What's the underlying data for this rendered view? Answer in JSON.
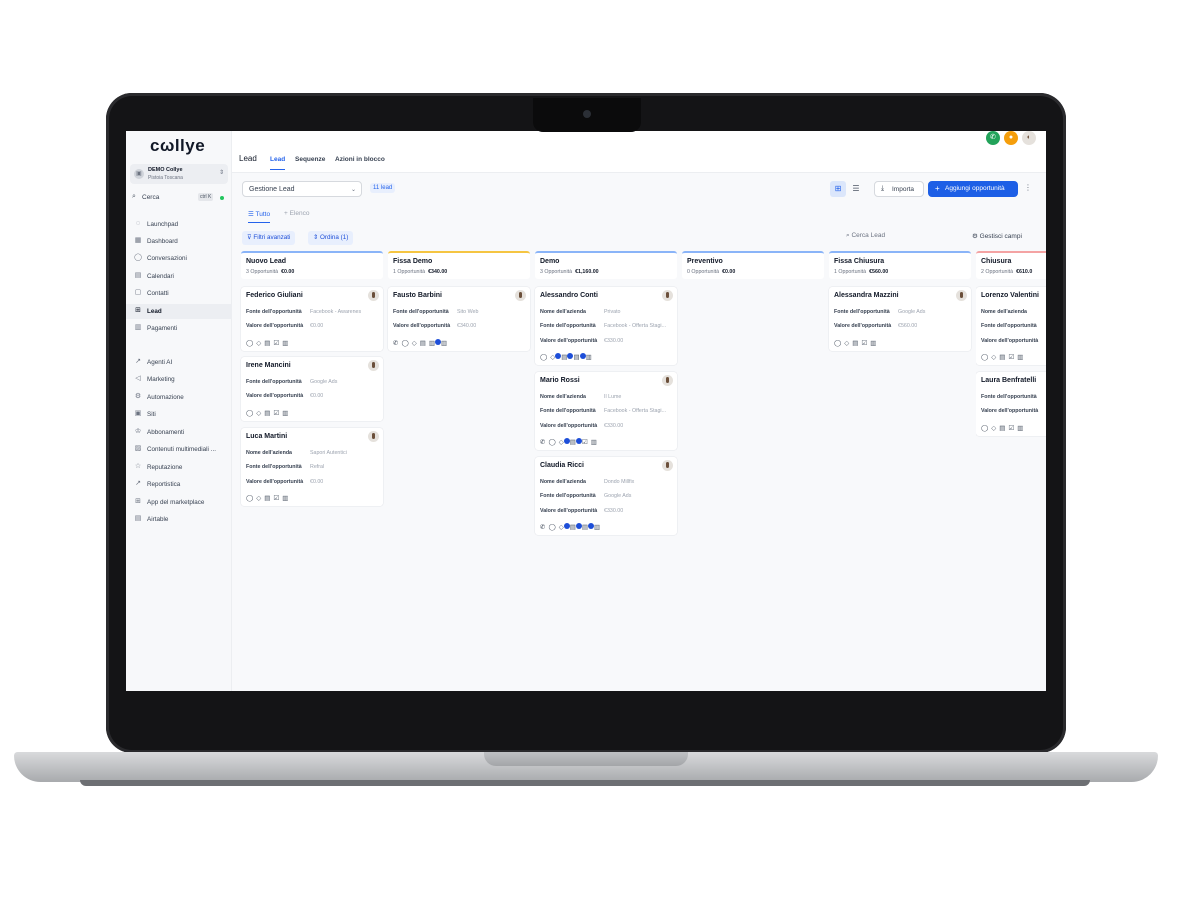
{
  "sidebar": {
    "logo": "cωllye",
    "account": {
      "name": "DEMO Collye",
      "location": "Pistoia Toscana"
    },
    "search": {
      "label": "Cerca",
      "shortcut": "ctrl K"
    },
    "items": [
      {
        "label": "Launchpad",
        "icon": "rocket-icon"
      },
      {
        "label": "Dashboard",
        "icon": "dashboard-icon"
      },
      {
        "label": "Conversazioni",
        "icon": "chat-icon"
      },
      {
        "label": "Calendari",
        "icon": "calendar-icon"
      },
      {
        "label": "Contatti",
        "icon": "contacts-icon"
      },
      {
        "label": "Lead",
        "icon": "lead-icon"
      },
      {
        "label": "Pagamenti",
        "icon": "payments-icon"
      },
      {
        "label": "Agenti AI",
        "icon": "ai-icon"
      },
      {
        "label": "Marketing",
        "icon": "send-icon"
      },
      {
        "label": "Automazione",
        "icon": "automation-icon"
      },
      {
        "label": "Siti",
        "icon": "sites-icon"
      },
      {
        "label": "Abbonamenti",
        "icon": "subscription-icon"
      },
      {
        "label": "Contenuti multimediali ...",
        "icon": "media-icon"
      },
      {
        "label": "Reputazione",
        "icon": "star-icon"
      },
      {
        "label": "Reportistica",
        "icon": "chart-icon"
      },
      {
        "label": "App del marketplace",
        "icon": "apps-icon"
      },
      {
        "label": "Airtable",
        "icon": "table-icon"
      }
    ]
  },
  "header": {
    "title": "Lead",
    "tabs": [
      "Lead",
      "Sequenze",
      "Azioni in blocco"
    ]
  },
  "toolbar": {
    "pipeline": "Gestione Lead",
    "lead_count": "11 lead",
    "import_label": "Importa",
    "add_label": "Aggiungi opportunità"
  },
  "subtabs": {
    "all": "Tutto",
    "list": "Elenco"
  },
  "filters": {
    "advanced": "Filtri avanzati",
    "sort": "Ordina (1)",
    "search_placeholder": "Cerca Lead",
    "manage_fields": "Gestisci campi"
  },
  "labels": {
    "source": "Fonte dell'opportunità",
    "value": "Valore dell'opportunità",
    "company": "Nome dell'azienda"
  },
  "columns": [
    {
      "title": "Nuovo Lead",
      "count": "3 Opportunità",
      "amount": "€0.00",
      "cards": [
        {
          "name": "Federico Giuliani",
          "source": "Facebook - Awarenes",
          "value": "€0.00"
        },
        {
          "name": "Irene Mancini",
          "source": "Google Ads",
          "value": "€0.00"
        },
        {
          "name": "Luca Martini",
          "company": "Sapori Autentici",
          "source": "Refral",
          "value": "€0.00"
        }
      ]
    },
    {
      "title": "Fissa Demo",
      "count": "1 Opportunità",
      "amount": "€340.00",
      "cards": [
        {
          "name": "Fausto Barbini",
          "source": "Sito Web",
          "value": "€340.00"
        }
      ]
    },
    {
      "title": "Demo",
      "count": "3 Opportunità",
      "amount": "€1,160.00",
      "cards": [
        {
          "name": "Alessandro Conti",
          "company": "Privato",
          "source": "Facebook - Offerta Stagi...",
          "value": "€330.00"
        },
        {
          "name": "Mario Rossi",
          "company": "Il Lume",
          "source": "Facebook - Offerta Stagi...",
          "value": "€330.00"
        },
        {
          "name": "Claudia Ricci",
          "company": "Dondo Millfix",
          "source": "Google Ads",
          "value": "€330.00"
        }
      ]
    },
    {
      "title": "Preventivo",
      "count": "0 Opportunità",
      "amount": "€0.00",
      "cards": []
    },
    {
      "title": "Fissa Chiusura",
      "count": "1 Opportunità",
      "amount": "€560.00",
      "cards": [
        {
          "name": "Alessandra Mazzini",
          "source": "Google Ads",
          "value": "€560.00"
        }
      ]
    },
    {
      "title": "Chiusura",
      "count": "2 Opportunità",
      "amount": "€610.0",
      "cards": [
        {
          "name": "Lorenzo Valentini"
        },
        {
          "name": "Laura Benfratelli"
        }
      ]
    }
  ]
}
